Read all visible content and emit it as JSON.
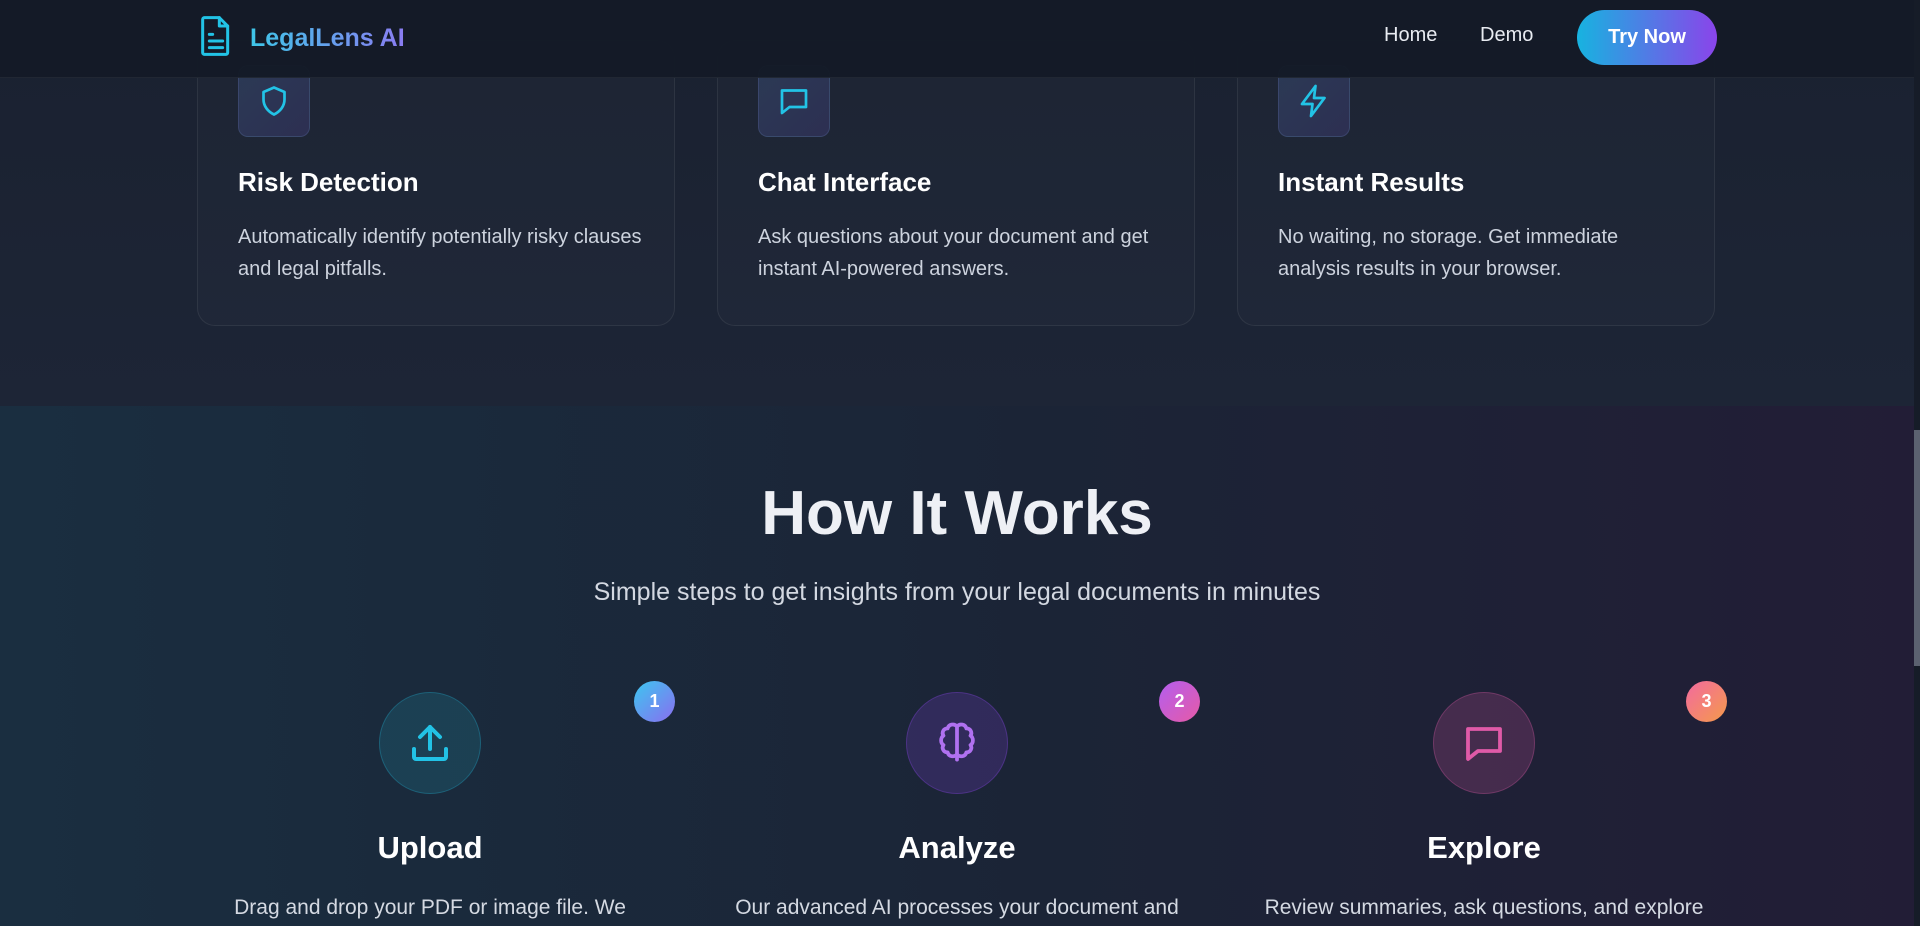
{
  "nav": {
    "brand": "LegalLens AI",
    "links": [
      "Home",
      "Demo"
    ],
    "cta": "Try Now"
  },
  "features": [
    {
      "icon": "shield-icon",
      "title": "Risk Detection",
      "description": "Automatically identify potentially risky clauses and legal pitfalls."
    },
    {
      "icon": "chat-icon",
      "title": "Chat Interface",
      "description": "Ask questions about your document and get instant AI-powered answers."
    },
    {
      "icon": "lightning-icon",
      "title": "Instant Results",
      "description": "No waiting, no storage. Get immediate analysis results in your browser."
    }
  ],
  "how": {
    "title": "How It Works",
    "subtitle": "Simple steps to get insights from your legal documents in minutes",
    "steps": [
      {
        "number": "1",
        "icon": "upload-icon",
        "title": "Upload",
        "description": "Drag and drop your PDF or image file. We"
      },
      {
        "number": "2",
        "icon": "brain-icon",
        "title": "Analyze",
        "description": "Our advanced AI processes your document and"
      },
      {
        "number": "3",
        "icon": "chat-icon",
        "title": "Explore",
        "description": "Review summaries, ask questions, and explore"
      }
    ]
  },
  "colors": {
    "accent_cyan": "#22c3e6",
    "accent_purple": "#8a44ea",
    "accent_pink": "#e05aa8",
    "background": "#1b2332"
  }
}
